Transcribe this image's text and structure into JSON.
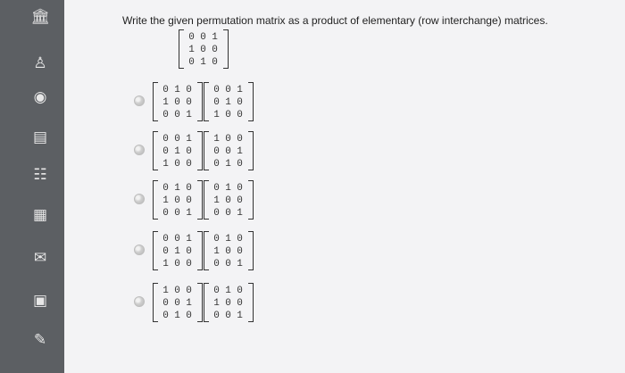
{
  "instruction": "Write the given permutation matrix as a product of elementary (row interchange) matrices.",
  "given_matrix": [
    [
      "0",
      "0",
      "1"
    ],
    [
      "1",
      "0",
      "0"
    ],
    [
      "0",
      "1",
      "0"
    ]
  ],
  "options": [
    {
      "left": [
        [
          "0",
          "1",
          "0"
        ],
        [
          "1",
          "0",
          "0"
        ],
        [
          "0",
          "0",
          "1"
        ]
      ],
      "right": [
        [
          "0",
          "0",
          "1"
        ],
        [
          "0",
          "1",
          "0"
        ],
        [
          "1",
          "0",
          "0"
        ]
      ]
    },
    {
      "left": [
        [
          "0",
          "0",
          "1"
        ],
        [
          "0",
          "1",
          "0"
        ],
        [
          "1",
          "0",
          "0"
        ]
      ],
      "right": [
        [
          "1",
          "0",
          "0"
        ],
        [
          "0",
          "0",
          "1"
        ],
        [
          "0",
          "1",
          "0"
        ]
      ]
    },
    {
      "left": [
        [
          "0",
          "1",
          "0"
        ],
        [
          "1",
          "0",
          "0"
        ],
        [
          "0",
          "0",
          "1"
        ]
      ],
      "right": [
        [
          "0",
          "1",
          "0"
        ],
        [
          "1",
          "0",
          "0"
        ],
        [
          "0",
          "0",
          "1"
        ]
      ]
    },
    {
      "left": [
        [
          "0",
          "0",
          "1"
        ],
        [
          "0",
          "1",
          "0"
        ],
        [
          "1",
          "0",
          "0"
        ]
      ],
      "right": [
        [
          "0",
          "1",
          "0"
        ],
        [
          "1",
          "0",
          "0"
        ],
        [
          "0",
          "0",
          "1"
        ]
      ]
    },
    {
      "left": [
        [
          "1",
          "0",
          "0"
        ],
        [
          "0",
          "0",
          "1"
        ],
        [
          "0",
          "1",
          "0"
        ]
      ],
      "right": [
        [
          "0",
          "1",
          "0"
        ],
        [
          "1",
          "0",
          "0"
        ],
        [
          "0",
          "0",
          "1"
        ]
      ]
    }
  ],
  "sidebar": {
    "icons": [
      "bank-icon",
      "person-icon",
      "globe-icon",
      "list-icon",
      "group-icon",
      "calendar-icon",
      "mail-icon",
      "chat-icon",
      "edit-icon"
    ]
  }
}
